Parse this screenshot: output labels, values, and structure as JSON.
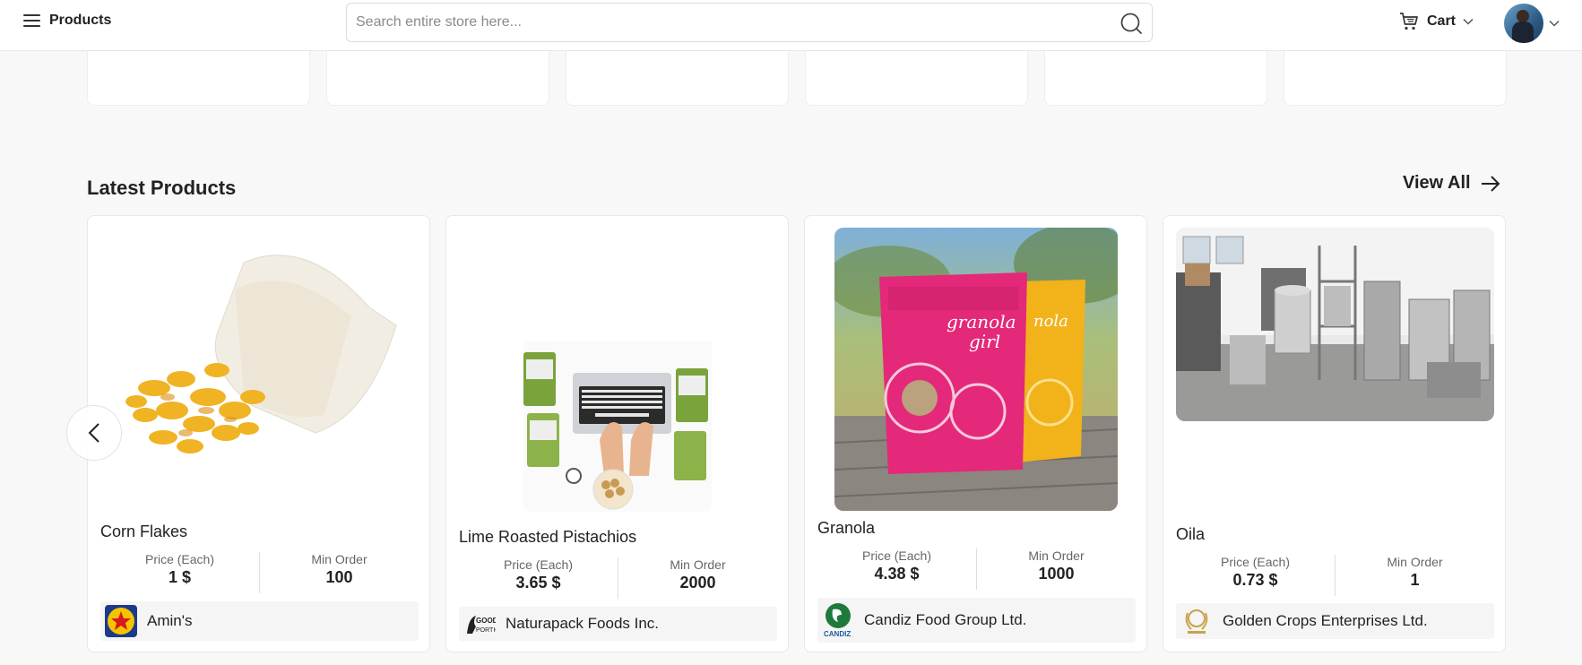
{
  "header": {
    "menu_label": "Products",
    "search_placeholder": "Search entire store here...",
    "cart_label": "Cart"
  },
  "section": {
    "title": "Latest Products",
    "view_all_label": "View All"
  },
  "products": [
    {
      "name": "Corn Flakes",
      "price_label": "Price (Each)",
      "price": "1 $",
      "min_order_label": "Min Order",
      "min_order": "100",
      "supplier": "Amin's"
    },
    {
      "name": "Lime Roasted Pistachios",
      "price_label": "Price (Each)",
      "price": "3.65 $",
      "min_order_label": "Min Order",
      "min_order": "2000",
      "supplier": "Naturapack Foods Inc."
    },
    {
      "name": "Granola",
      "price_label": "Price (Each)",
      "price": "4.38 $",
      "min_order_label": "Min Order",
      "min_order": "1000",
      "supplier": "Candiz Food Group Ltd."
    },
    {
      "name": "Oila",
      "price_label": "Price (Each)",
      "price": "0.73 $",
      "min_order_label": "Min Order",
      "min_order": "1",
      "supplier": "Golden Crops Enterprises Ltd."
    }
  ],
  "icons": {
    "menu": "hamburger-icon",
    "search": "search-icon",
    "cart": "cart-icon",
    "dropdown": "chevron-down-icon",
    "view_all": "arrow-right-icon",
    "prev": "chevron-left-icon"
  }
}
